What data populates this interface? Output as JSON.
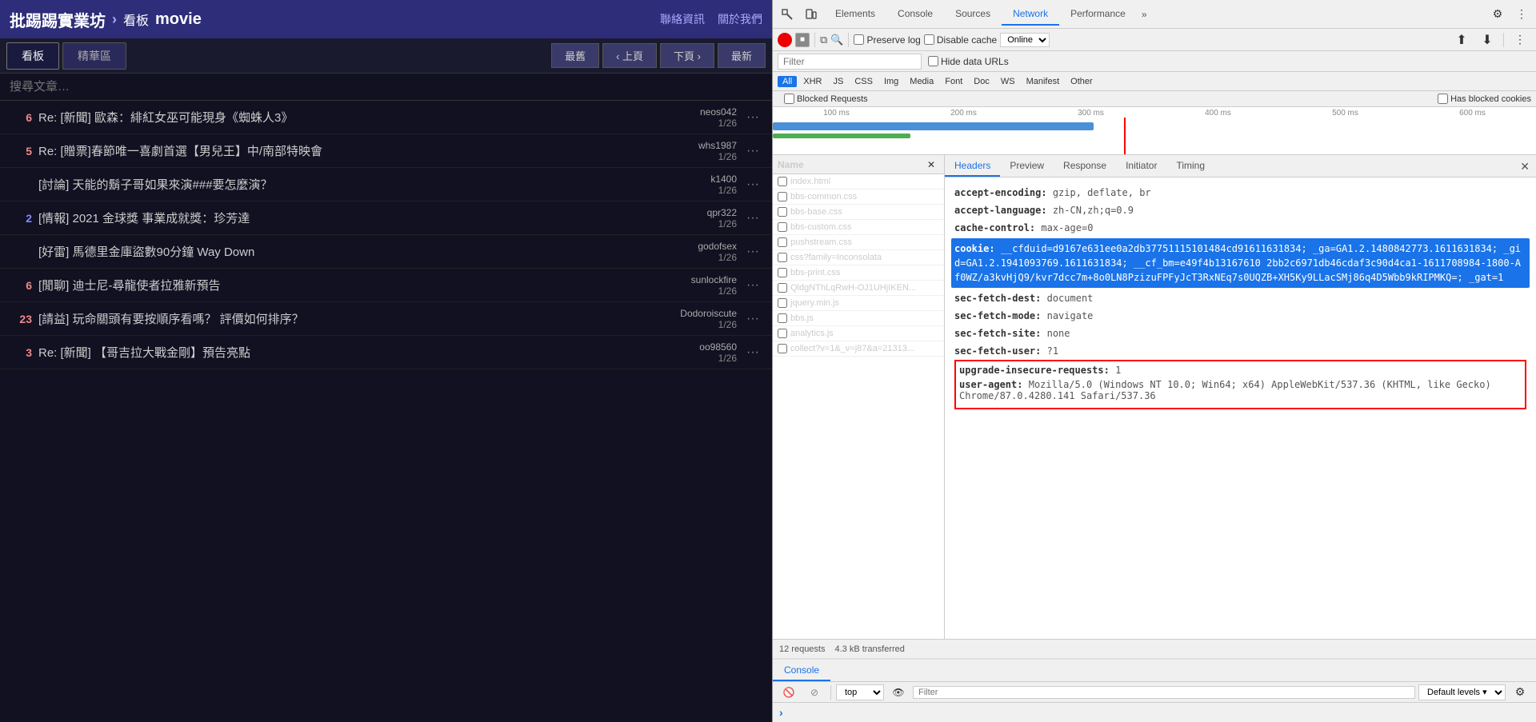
{
  "bbs": {
    "site_name": "批踢踢實業坊",
    "breadcrumb_arrow": "›",
    "board_label": "看板",
    "board_name": "movie",
    "nav_links": [
      "聯絡資訊",
      "關於我們"
    ],
    "tabs": [
      {
        "label": "看板",
        "active": true
      },
      {
        "label": "精華區",
        "active": false
      }
    ],
    "nav_buttons": [
      "最舊",
      "‹ 上頁",
      "下頁 ›",
      "最新"
    ],
    "search_placeholder": "搜尋文章…",
    "posts": [
      {
        "score": "6",
        "score_class": "positive",
        "title": "Re: [新聞] 歐森：緋紅女巫可能現身《蜘蛛人3》",
        "author": "neos042",
        "date": "1/26",
        "has_more": true
      },
      {
        "score": "5",
        "score_class": "positive",
        "title": "Re: [贈票]春節唯一喜劇首選【男兒王】中/南部特映會",
        "author": "whs1987",
        "date": "1/26",
        "has_more": true
      },
      {
        "score": " ",
        "score_class": "zero",
        "title": "[討論] 天能的鬍子哥如果來演###要怎麼演？",
        "author": "k1400",
        "date": "1/26",
        "has_more": true
      },
      {
        "score": "2",
        "score_class": "blue",
        "title": "[情報] 2021 金球獎 事業成就獎：珍芳達",
        "author": "qpr322",
        "date": "1/26",
        "has_more": true
      },
      {
        "score": " ",
        "score_class": "zero",
        "title": "[好雷] 馬德里金庫盜數90分鐘 Way Down",
        "author": "godofsex",
        "date": "1/26",
        "has_more": true
      },
      {
        "score": "6",
        "score_class": "positive",
        "title": "[閒聊] 迪士尼-尋龍使者拉雅新預告",
        "author": "sunlockfire",
        "date": "1/26",
        "has_more": true
      },
      {
        "score": "23",
        "score_class": "positive",
        "title": "[請益] 玩命關頭有要按順序看嗎？ 評價如何排序？",
        "author": "Dodoroiscute",
        "date": "1/26",
        "has_more": true
      },
      {
        "score": "3",
        "score_class": "positive",
        "title": "Re: [新聞] 【哥吉拉大戰金剛】預告亮點",
        "author": "oo98560",
        "date": "1/26",
        "has_more": true
      }
    ]
  },
  "devtools": {
    "top_tabs": [
      "Elements",
      "Console",
      "Sources",
      "Network",
      "Performance"
    ],
    "active_tab": "Network",
    "settings_icon": "⚙",
    "more_icon": "⋮",
    "network": {
      "toolbar": {
        "record_title": "Record",
        "stop_title": "Stop",
        "filter_title": "Filter",
        "search_title": "Search",
        "preserve_log_label": "Preserve log",
        "disable_cache_label": "Disable cache",
        "online_options": [
          "Online"
        ],
        "import_title": "Import",
        "export_title": "Export"
      },
      "filter_bar": {
        "placeholder": "Filter",
        "hide_data_urls_label": "Hide data URLs"
      },
      "type_filters": [
        "All",
        "XHR",
        "JS",
        "CSS",
        "Img",
        "Media",
        "Font",
        "Doc",
        "WS",
        "Manifest",
        "Other"
      ],
      "active_type": "All",
      "blocked_requests_label": "Blocked Requests",
      "has_blocked_cookies_label": "Has blocked cookies",
      "timeline": {
        "labels": [
          "100 ms",
          "200 ms",
          "300 ms",
          "400 ms",
          "500 ms",
          "600 ms"
        ],
        "blue_bar": {
          "left_pct": 0,
          "width_pct": 42
        },
        "green_bar": {
          "left_pct": 0,
          "width_pct": 18
        },
        "red_line_pct": 46
      },
      "files": [
        {
          "name": "index.html",
          "selected": false
        },
        {
          "name": "bbs-common.css",
          "selected": false
        },
        {
          "name": "bbs-base.css",
          "selected": false
        },
        {
          "name": "bbs-custom.css",
          "selected": false
        },
        {
          "name": "pushstream.css",
          "selected": false
        },
        {
          "name": "css?family=Inconsolata",
          "selected": false
        },
        {
          "name": "bbs-print.css",
          "selected": false
        },
        {
          "name": "QldgNThLqRwH-OJ1UHjIKEN...",
          "selected": false
        },
        {
          "name": "jquery.min.js",
          "selected": false
        },
        {
          "name": "bbs.js",
          "selected": false
        },
        {
          "name": "analytics.js",
          "selected": false
        },
        {
          "name": "collect?v=1&_v=j87&a=21313...",
          "selected": false
        }
      ],
      "footer": {
        "requests": "12 requests",
        "transferred": "4.3 kB transferred"
      },
      "headers_tabs": [
        "Headers",
        "Preview",
        "Response",
        "Initiator",
        "Timing"
      ],
      "active_headers_tab": "Headers",
      "headers": [
        {
          "name": "accept-encoding:",
          "value": "gzip, deflate, br",
          "highlight": false,
          "red_box": false
        },
        {
          "name": "accept-language:",
          "value": "zh-CN,zh;q=0.9",
          "highlight": false,
          "red_box": false
        },
        {
          "name": "cache-control:",
          "value": "max-age=0",
          "highlight": false,
          "red_box": false
        },
        {
          "name": "cookie:",
          "value": "__cfduid=d9167e631ee0a2db37751115101484cd91611631834; _ga=GA1.2.1480842773.1611631834; _gid=GA1.2.1941093769.1611631834; __cf_bm=e49f4b13167610 2bb2c6971db46cdaf3c90d4ca1-1611708984-1800-Af0WZ/a3kvHjQ9/kvr7dcc7m+8o0LN8PzizuFPFyJcT3RxNEq7s0UQZB+XH5Ky9LLacSMj86q4D5Wbb9kRIPMKQ=; _gat=1",
          "highlight": true,
          "red_box": false
        },
        {
          "name": "sec-fetch-dest:",
          "value": "document",
          "highlight": false,
          "red_box": false
        },
        {
          "name": "sec-fetch-mode:",
          "value": "navigate",
          "highlight": false,
          "red_box": false
        },
        {
          "name": "sec-fetch-site:",
          "value": "none",
          "highlight": false,
          "red_box": false
        },
        {
          "name": "sec-fetch-user:",
          "value": "?1",
          "highlight": false,
          "red_box": false
        },
        {
          "name": "upgrade-insecure-requests:",
          "value": "1",
          "highlight": false,
          "red_box": true
        },
        {
          "name": "user-agent:",
          "value": "Mozilla/5.0 (Windows NT 10.0; Win64; x64) AppleWebKit/537.36 (KHTML, like Gecko) Chrome/87.0.4280.141 Safari/537.36",
          "highlight": false,
          "red_box": true
        }
      ]
    },
    "console": {
      "tabs": [
        "Console"
      ],
      "active_tab": "Console",
      "context": "top",
      "filter_placeholder": "Filter",
      "levels": "Default levels ▾",
      "prompt": "›"
    }
  }
}
